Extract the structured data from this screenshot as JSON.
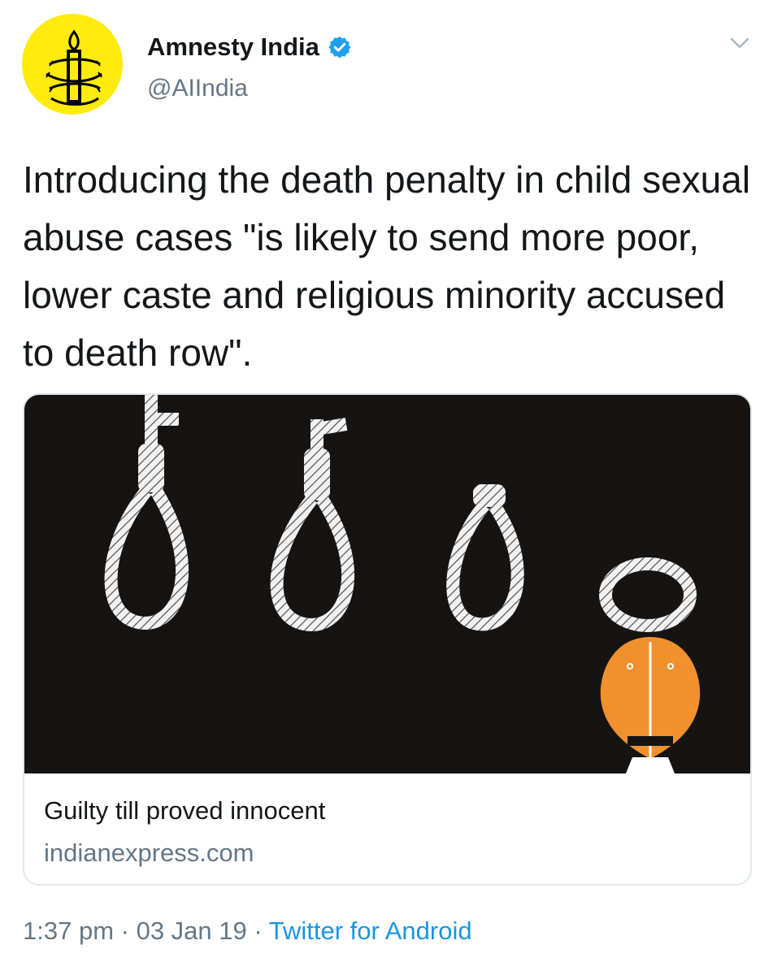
{
  "author": {
    "display_name": "Amnesty India",
    "handle": "@AIIndia",
    "verified": true,
    "avatar": "amnesty-candle-logo",
    "avatar_color": "#ffeb0c"
  },
  "tweet": {
    "text": "Introducing the death penalty in child sexual abuse cases \"is likely to send more poor, lower caste and religious minority accused to death row\"."
  },
  "card": {
    "title": "Guilty till proved innocent",
    "domain": "indianexpress.com",
    "image": "nooses-illustration"
  },
  "meta": {
    "time": "1:37 pm",
    "separator_1": " · ",
    "date": "03 Jan 19",
    "separator_2": " · ",
    "source": "Twitter for Android"
  },
  "colors": {
    "text": "#14171a",
    "secondary": "#657786",
    "link": "#1b95e0",
    "verified": "#1da1f2",
    "card_bg": "#151413",
    "figure_orange": "#f0912e"
  }
}
